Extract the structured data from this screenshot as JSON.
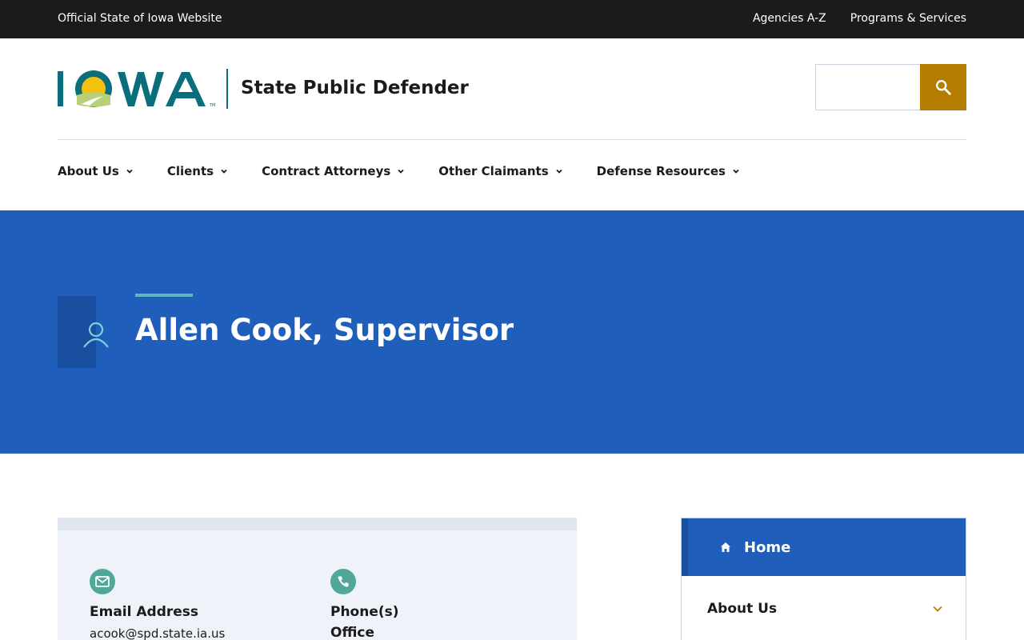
{
  "topbar": {
    "official": "Official State of Iowa Website",
    "links": [
      "Agencies A-Z",
      "Programs & Services"
    ]
  },
  "header": {
    "logo_text": "IOWA",
    "agency_name": "State Public Defender",
    "search": {
      "placeholder": "",
      "button_icon": "search-icon"
    }
  },
  "nav": {
    "items": [
      {
        "label": "About Us"
      },
      {
        "label": "Clients"
      },
      {
        "label": "Contract Attorneys"
      },
      {
        "label": "Other Claimants"
      },
      {
        "label": "Defense Resources"
      }
    ]
  },
  "hero": {
    "icon": "person-icon",
    "title": "Allen Cook, Supervisor"
  },
  "contact": {
    "email": {
      "icon": "envelope-icon",
      "label": "Email Address",
      "value": "acook@spd.state.ia.us"
    },
    "phone": {
      "icon": "phone-icon",
      "label": "Phone(s)",
      "sub": "Office"
    }
  },
  "sidenav": {
    "home": {
      "icon": "home-icon",
      "label": "Home"
    },
    "about": {
      "label": "About Us",
      "icon": "chevron-down-icon"
    }
  },
  "colors": {
    "topbar": "#1b1b1b",
    "brand_blue": "#1f5fbb",
    "brand_teal": "#0a6e7d",
    "search_gold": "#b57d00",
    "contact_green": "#4fa89a"
  }
}
